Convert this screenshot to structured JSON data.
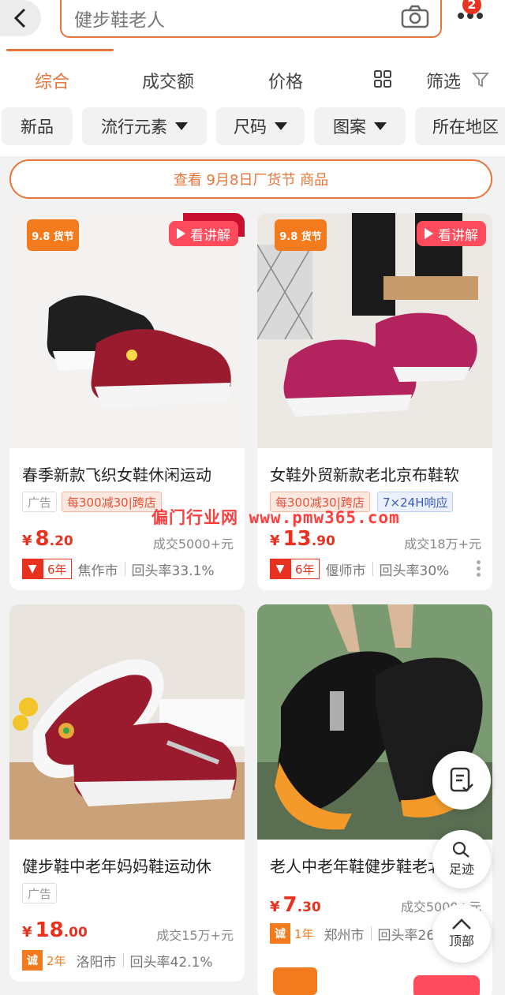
{
  "header": {
    "search_query": "健步鞋老人",
    "cart_badge": "2",
    "icons": [
      "back-icon",
      "camera-icon",
      "more-icon"
    ]
  },
  "sort_tabs": {
    "items": [
      "综合",
      "成交额",
      "价格"
    ],
    "active": "综合",
    "filter_label": "筛选"
  },
  "filter_chips": [
    {
      "label": "新品",
      "dropdown": false
    },
    {
      "label": "流行元素",
      "dropdown": true
    },
    {
      "label": "尺码",
      "dropdown": true
    },
    {
      "label": "图案",
      "dropdown": true
    },
    {
      "label": "所在地区",
      "dropdown": false
    }
  ],
  "festival_banner": "查看 9月8日厂货节 商品",
  "products": [
    {
      "title": "春季新款飞织女鞋休闲运动",
      "festival_tag": "9.8 货节",
      "video_badge": "看讲解",
      "tags": [
        "广告",
        "每300减30|跨店"
      ],
      "price_int": "8",
      "price_dec": ".20",
      "deal": "成交5000+元",
      "seller_years": "6年",
      "city": "焦作市",
      "repeat_rate": "回头率33.1%"
    },
    {
      "title": "女鞋外贸新款老北京布鞋软",
      "festival_tag": "9.8 货节",
      "video_badge": "看讲解",
      "tags": [
        "每300减30|跨店",
        "7×24H响应"
      ],
      "price_int": "13",
      "price_dec": ".90",
      "deal": "成交18万+元",
      "seller_years": "6年",
      "city": "偃师市",
      "repeat_rate": "回头率30%"
    },
    {
      "title": "健步鞋中老年妈妈鞋运动休",
      "tags": [
        "广告"
      ],
      "price_int": "18",
      "price_dec": ".00",
      "deal": "成交15万+元",
      "seller_years": "2年",
      "city": "洛阳市",
      "repeat_rate": "回头率42.1%"
    },
    {
      "title": "老人中老年鞋健步鞋老北京",
      "tags": [],
      "price_int": "7",
      "price_dec": ".30",
      "deal": "成交5000+元",
      "seller_years": "1年",
      "city": "郑州市",
      "repeat_rate": "回头率26.4%"
    }
  ],
  "currency": "¥",
  "seller_logo_text": "诚",
  "watermark": "偏门行业网 www.pmw365.com",
  "floating": {
    "footprint_label": "足迹",
    "top_label": "顶部"
  },
  "colors": {
    "accent": "#e8753a",
    "price": "#e8321f",
    "badge_red": "#ff4b5c"
  }
}
